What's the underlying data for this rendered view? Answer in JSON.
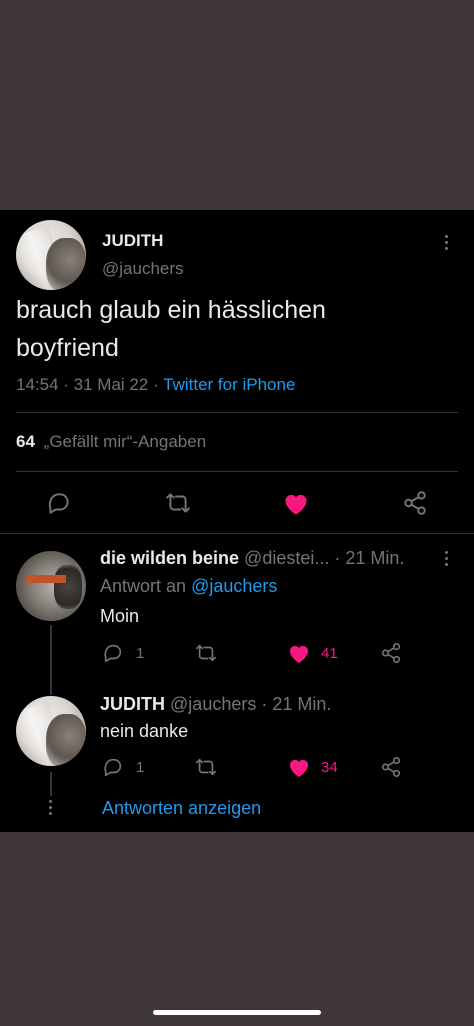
{
  "main_tweet": {
    "display_name": "JUDITH",
    "handle": "@jauchers",
    "text_line1": "brauch glaub ein hässlichen",
    "text_line2": "boyfriend",
    "timestamp": "14:54 · 31 Mai 22 ·",
    "source": "Twitter for iPhone",
    "likes_count": "64",
    "likes_label": "„Gefällt mir“-Angaben",
    "liked": true
  },
  "replies": [
    {
      "display_name": "die wilden beine",
      "handle": "@diestei...",
      "time": "· 21 Min.",
      "reply_to_prefix": "Antwort an",
      "reply_to_handle": "@jauchers",
      "text": "Moin",
      "reply_count": "1",
      "like_count": "41",
      "liked": true
    },
    {
      "display_name": "JUDITH",
      "handle": "@jauchers",
      "time": "· 21 Min.",
      "text": "nein danke",
      "reply_count": "1",
      "like_count": "34",
      "liked": true
    }
  ],
  "show_replies_label": "Antworten anzeigen",
  "colors": {
    "background": "#3f3638",
    "card": "#000000",
    "link": "#1d9bf0",
    "like": "#f91880",
    "muted": "#71767b",
    "text": "#e7e9ea"
  }
}
